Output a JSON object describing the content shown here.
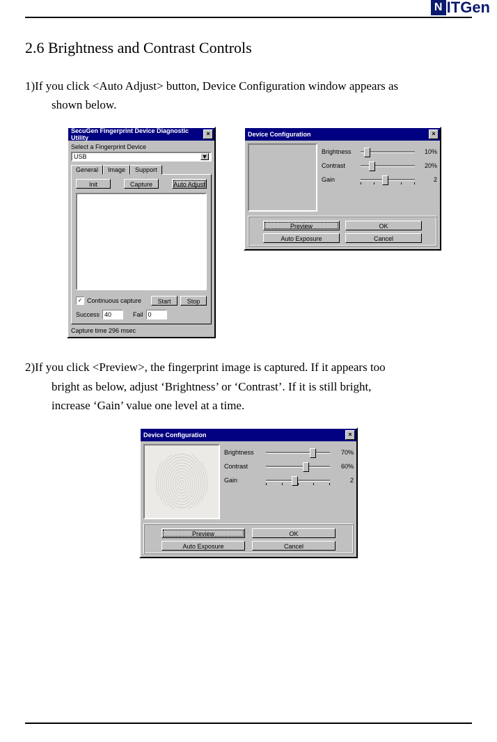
{
  "header": {
    "brand_rest": "ITGen"
  },
  "section": {
    "heading": "2.6 Brightness and Contrast Controls",
    "step1_line1": "1)If you click <Auto Adjust> button, Device Configuration window appears as",
    "step1_line2": "shown below.",
    "step2_line1": "2)If you click <Preview>, the fingerprint image is captured. If it appears too",
    "step2_line2": "bright as below, adjust ‘Brightness’ or ‘Contrast’. If it is still bright,",
    "step2_line3": "increase ‘Gain’ value one level at a time."
  },
  "winA": {
    "title": "SecuGen Fingerprint Device Diagnostic Utility",
    "select_label": "Select a Fingerprint Device",
    "device": "USB",
    "tabs": [
      "General",
      "Image",
      "Support"
    ],
    "btn_init": "Init",
    "btn_capture": "Capture",
    "btn_auto": "Auto Adjust",
    "chk_label": "Continuous capture",
    "btn_start": "Start",
    "btn_stop": "Stop",
    "success_label": "Success",
    "success_val": "40",
    "fail_label": "Fail",
    "fail_val": "0",
    "status": "Capture time 296 msec"
  },
  "winB": {
    "title": "Device Configuration",
    "sliders": [
      {
        "label": "Brightness",
        "value": "10%"
      },
      {
        "label": "Contrast",
        "value": "20%"
      },
      {
        "label": "Gain",
        "value": "2"
      }
    ],
    "btn_preview": "Preview",
    "btn_ok": "OK",
    "btn_autoexp": "Auto Exposure",
    "btn_cancel": "Cancel"
  },
  "winC": {
    "title": "Device Configuration",
    "sliders": [
      {
        "label": "Brightness",
        "value": "70%"
      },
      {
        "label": "Contrast",
        "value": "60%"
      },
      {
        "label": "Gain",
        "value": "2"
      }
    ],
    "btn_preview": "Preview",
    "btn_ok": "OK",
    "btn_autoexp": "Auto Exposure",
    "btn_cancel": "Cancel"
  }
}
